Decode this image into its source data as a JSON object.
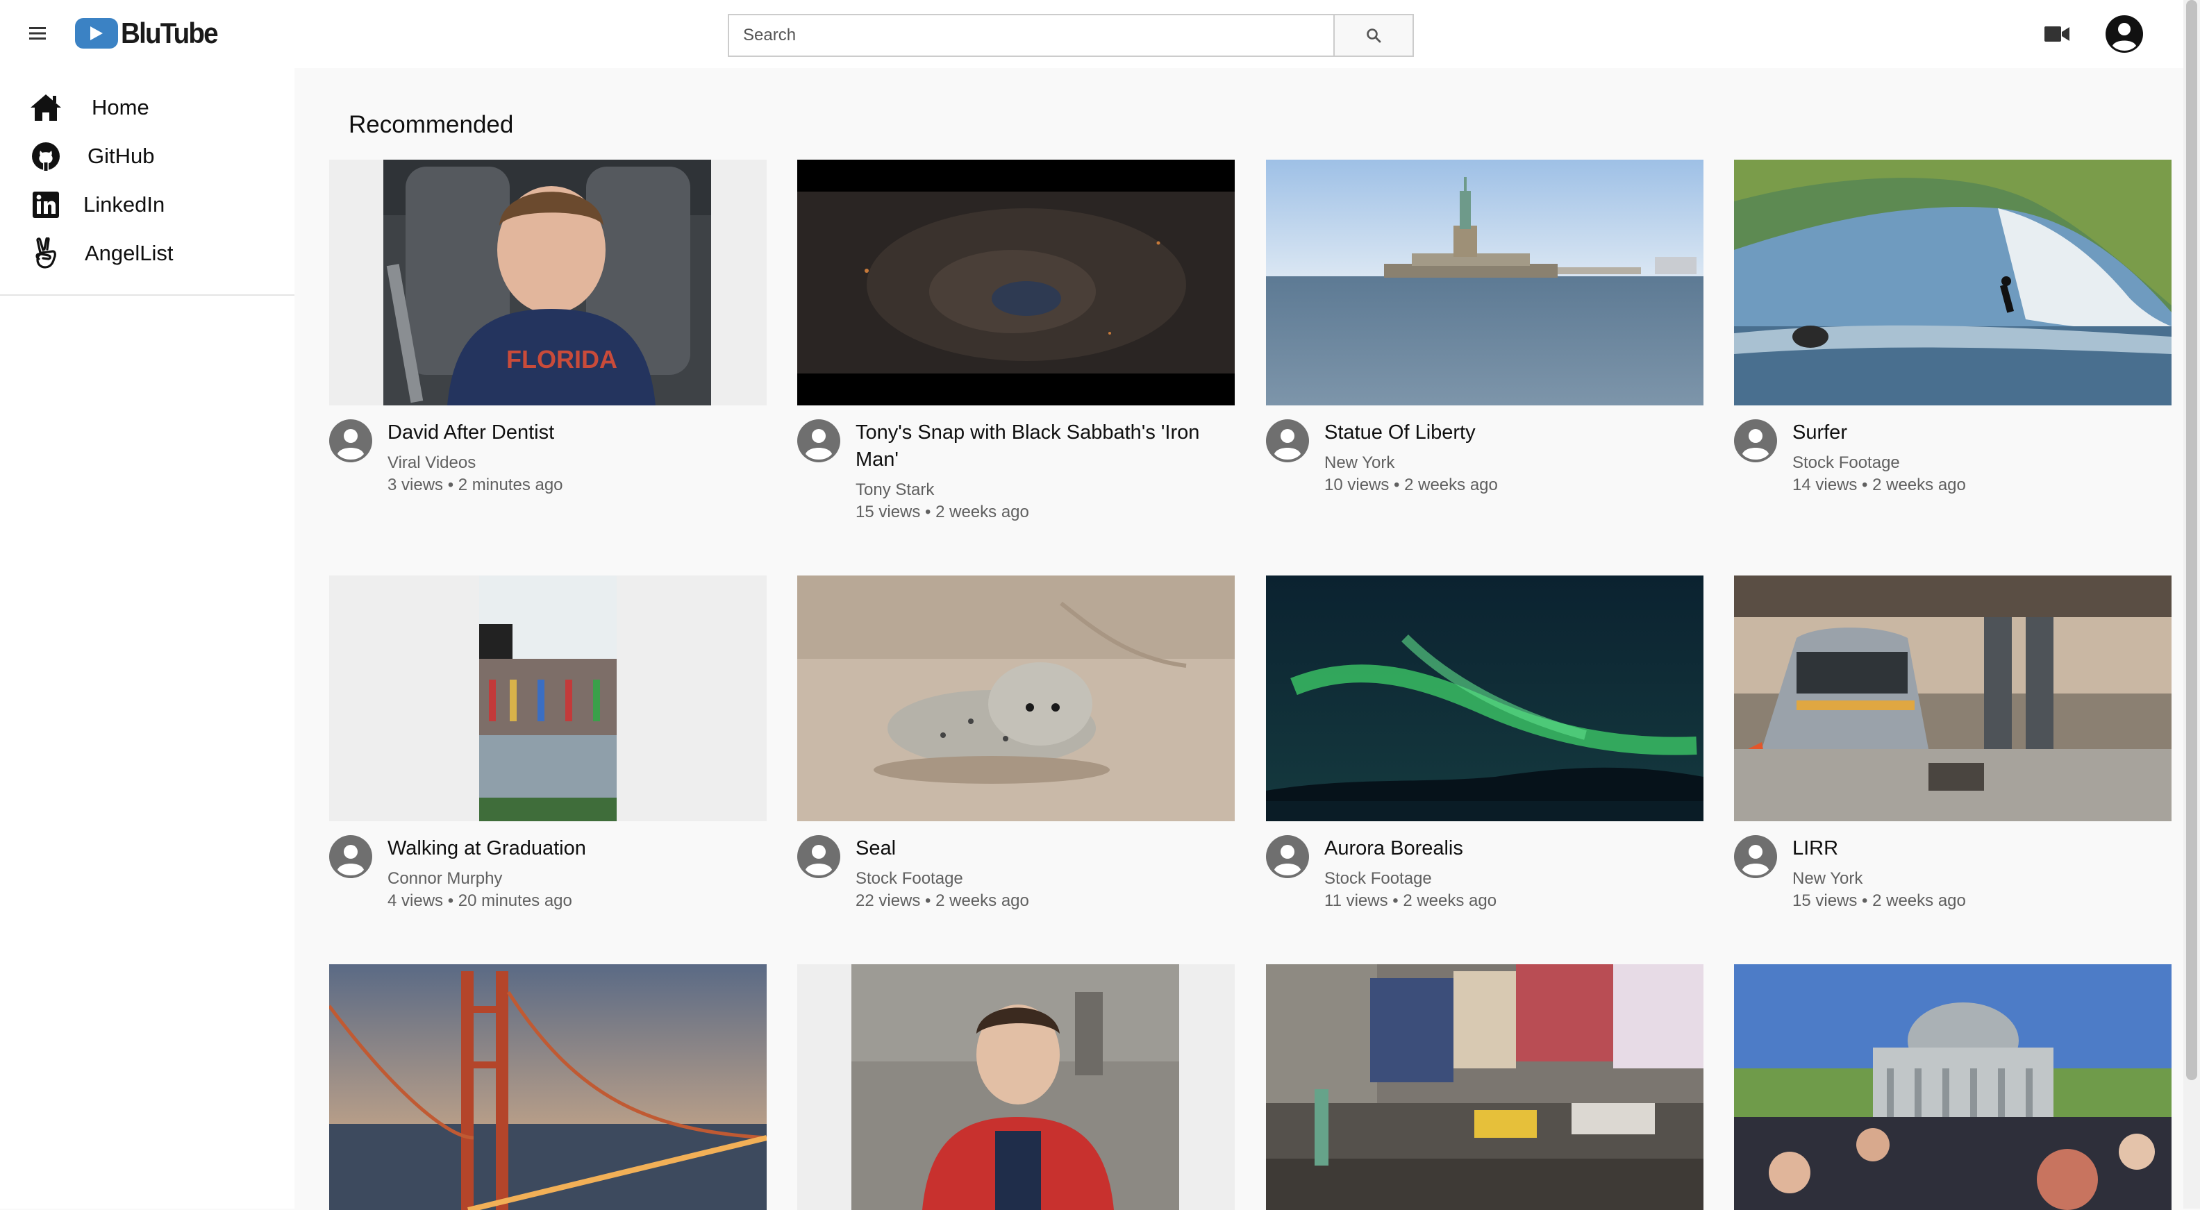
{
  "app": {
    "logo_text": "BluTube",
    "brand_color": "#3b82c4",
    "search_placeholder": "Search"
  },
  "icons": {
    "menu": "hamburger-menu-icon",
    "search": "magnifier-icon",
    "upload": "video-camera-icon",
    "account": "account-circle-icon"
  },
  "sidebar": {
    "items": [
      {
        "label": "Home",
        "icon": "home-icon"
      },
      {
        "label": "GitHub",
        "icon": "github-icon"
      },
      {
        "label": "LinkedIn",
        "icon": "linkedin-icon"
      },
      {
        "label": "AngelList",
        "icon": "angellist-icon"
      }
    ]
  },
  "main": {
    "section_title": "Recommended",
    "videos": [
      {
        "title": "David After Dentist",
        "channel": "Viral Videos",
        "stats": "3 views • 2 minutes ago"
      },
      {
        "title": "Tony's Snap with Black Sabbath's 'Iron Man'",
        "channel": "Tony Stark",
        "stats": "15 views • 2 weeks ago"
      },
      {
        "title": "Statue Of Liberty",
        "channel": "New York",
        "stats": "10 views • 2 weeks ago"
      },
      {
        "title": "Surfer",
        "channel": "Stock Footage",
        "stats": "14 views • 2 weeks ago"
      },
      {
        "title": "Walking at Graduation",
        "channel": "Connor Murphy",
        "stats": "4 views • 20 minutes ago"
      },
      {
        "title": "Seal",
        "channel": "Stock Footage",
        "stats": "22 views • 2 weeks ago"
      },
      {
        "title": "Aurora Borealis",
        "channel": "Stock Footage",
        "stats": "11 views • 2 weeks ago"
      },
      {
        "title": "LIRR",
        "channel": "New York",
        "stats": "15 views • 2 weeks ago"
      }
    ]
  }
}
